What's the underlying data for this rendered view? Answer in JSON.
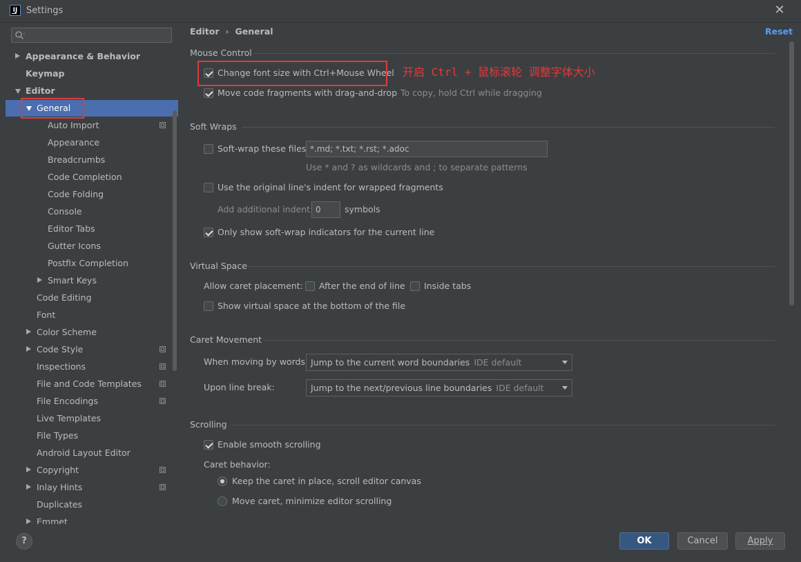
{
  "window": {
    "title": "Settings",
    "app_icon_text": "IJ"
  },
  "search": {
    "placeholder": ""
  },
  "tree": [
    {
      "label": "Appearance & Behavior",
      "bold": true,
      "indent": 0,
      "arrow": "right"
    },
    {
      "label": "Keymap",
      "bold": true,
      "indent": 0,
      "arrow": "none"
    },
    {
      "label": "Editor",
      "bold": true,
      "indent": 0,
      "arrow": "down"
    },
    {
      "label": "General",
      "bold": false,
      "indent": 1,
      "arrow": "down",
      "selected": true
    },
    {
      "label": "Auto Import",
      "indent": 2,
      "arrow": "none",
      "copy": true
    },
    {
      "label": "Appearance",
      "indent": 2,
      "arrow": "none"
    },
    {
      "label": "Breadcrumbs",
      "indent": 2,
      "arrow": "none"
    },
    {
      "label": "Code Completion",
      "indent": 2,
      "arrow": "none"
    },
    {
      "label": "Code Folding",
      "indent": 2,
      "arrow": "none"
    },
    {
      "label": "Console",
      "indent": 2,
      "arrow": "none"
    },
    {
      "label": "Editor Tabs",
      "indent": 2,
      "arrow": "none"
    },
    {
      "label": "Gutter Icons",
      "indent": 2,
      "arrow": "none"
    },
    {
      "label": "Postfix Completion",
      "indent": 2,
      "arrow": "none"
    },
    {
      "label": "Smart Keys",
      "indent": 2,
      "arrow": "right"
    },
    {
      "label": "Code Editing",
      "indent": 1,
      "arrow": "none"
    },
    {
      "label": "Font",
      "indent": 1,
      "arrow": "none"
    },
    {
      "label": "Color Scheme",
      "indent": 1,
      "arrow": "right"
    },
    {
      "label": "Code Style",
      "indent": 1,
      "arrow": "right",
      "copy": true
    },
    {
      "label": "Inspections",
      "indent": 1,
      "arrow": "none",
      "copy": true
    },
    {
      "label": "File and Code Templates",
      "indent": 1,
      "arrow": "none",
      "copy": true
    },
    {
      "label": "File Encodings",
      "indent": 1,
      "arrow": "none",
      "copy": true
    },
    {
      "label": "Live Templates",
      "indent": 1,
      "arrow": "none"
    },
    {
      "label": "File Types",
      "indent": 1,
      "arrow": "none"
    },
    {
      "label": "Android Layout Editor",
      "indent": 1,
      "arrow": "none"
    },
    {
      "label": "Copyright",
      "indent": 1,
      "arrow": "right",
      "copy": true
    },
    {
      "label": "Inlay Hints",
      "indent": 1,
      "arrow": "right",
      "copy": true
    },
    {
      "label": "Duplicates",
      "indent": 1,
      "arrow": "none"
    },
    {
      "label": "Emmet",
      "indent": 1,
      "arrow": "right"
    }
  ],
  "breadcrumb": {
    "first": "Editor",
    "separator": "›",
    "second": "General"
  },
  "reset_label": "Reset",
  "mouse_control": {
    "title": "Mouse Control",
    "change_font": {
      "label": "Change font size with Ctrl+Mouse Wheel",
      "checked": true
    },
    "drag_drop": {
      "label": "Move code fragments with drag-and-drop",
      "checked": true,
      "hint": "To copy, hold Ctrl while dragging"
    },
    "annotation": "开启 Ctrl + 鼠标滚轮 调整字体大小"
  },
  "soft_wraps": {
    "title": "Soft Wraps",
    "soft_wrap_files": {
      "label": "Soft-wrap these files:",
      "checked": false,
      "value": "*.md; *.txt; *.rst; *.adoc"
    },
    "wildcard_hint": "Use * and ? as wildcards and ; to separate patterns",
    "original_indent": {
      "label": "Use the original line's indent for wrapped fragments",
      "checked": false
    },
    "additional_indent": {
      "label": "Add additional indent:",
      "value": "0",
      "unit": "symbols"
    },
    "only_current_line": {
      "label": "Only show soft-wrap indicators for the current line",
      "checked": true
    }
  },
  "virtual_space": {
    "title": "Virtual Space",
    "caret_placement_label": "Allow caret placement:",
    "after_end": {
      "label": "After the end of line",
      "checked": false
    },
    "inside_tabs": {
      "label": "Inside tabs",
      "checked": false
    },
    "show_virtual": {
      "label": "Show virtual space at the bottom of the file",
      "checked": false
    }
  },
  "caret_movement": {
    "title": "Caret Movement",
    "words_label": "When moving by words:",
    "words_value": "Jump to the current word boundaries",
    "words_default": "IDE default",
    "linebreak_label": "Upon line break:",
    "linebreak_value": "Jump to the next/previous line boundaries",
    "linebreak_default": "IDE default"
  },
  "scrolling": {
    "title": "Scrolling",
    "smooth": {
      "label": "Enable smooth scrolling",
      "checked": true
    },
    "caret_behavior_label": "Caret behavior:",
    "keep_caret": {
      "label": "Keep the caret in place, scroll editor canvas",
      "selected": true
    },
    "move_caret": {
      "label": "Move caret, minimize editor scrolling",
      "selected": false
    }
  },
  "buttons": {
    "ok": "OK",
    "cancel": "Cancel",
    "apply": "Apply",
    "help": "?"
  },
  "colors": {
    "accent": "#4b6eaf",
    "link": "#589df6",
    "annotation_red": "#e23a3a",
    "primary_button": "#365880"
  }
}
